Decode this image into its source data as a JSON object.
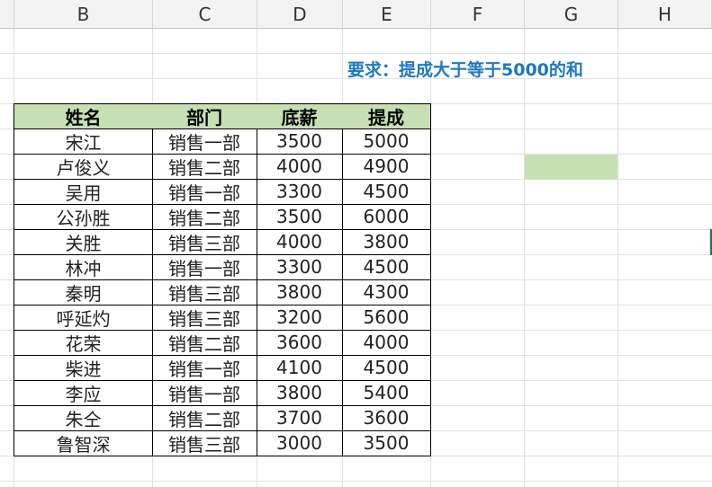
{
  "columns": [
    "B",
    "C",
    "D",
    "E",
    "F",
    "G",
    "H"
  ],
  "requirement": "要求：提成大于等于5000的和",
  "table": {
    "headers": [
      "姓名",
      "部门",
      "底薪",
      "提成"
    ],
    "rows": [
      [
        "宋江",
        "销售一部",
        "3500",
        "5000"
      ],
      [
        "卢俊义",
        "销售二部",
        "4000",
        "4900"
      ],
      [
        "吴用",
        "销售一部",
        "3300",
        "4500"
      ],
      [
        "公孙胜",
        "销售二部",
        "3500",
        "6000"
      ],
      [
        "关胜",
        "销售三部",
        "4000",
        "3800"
      ],
      [
        "林冲",
        "销售一部",
        "3300",
        "4500"
      ],
      [
        "秦明",
        "销售三部",
        "3800",
        "4300"
      ],
      [
        "呼延灼",
        "销售三部",
        "3200",
        "5600"
      ],
      [
        "花荣",
        "销售二部",
        "3600",
        "4000"
      ],
      [
        "柴进",
        "销售一部",
        "4100",
        "4500"
      ],
      [
        "李应",
        "销售一部",
        "3800",
        "5400"
      ],
      [
        "朱仝",
        "销售二部",
        "3700",
        "3600"
      ],
      [
        "鲁智深",
        "销售三部",
        "3000",
        "3500"
      ]
    ]
  },
  "colors": {
    "header_fill": "#c6e0b4",
    "selected_cell_fill": "#c6e0b4",
    "requirement_text": "#1f78c1"
  }
}
